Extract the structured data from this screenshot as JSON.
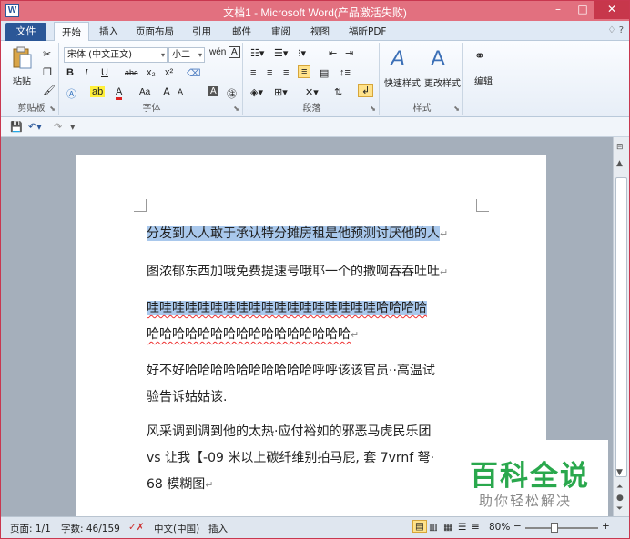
{
  "window": {
    "title": "文档1 - Microsoft Word(产品激活失败)",
    "app_icon": "W",
    "minimize": "–",
    "maximize": "□",
    "close": "✕"
  },
  "ribbon_tabs": {
    "file": "文件",
    "items": [
      "开始",
      "插入",
      "页面布局",
      "引用",
      "邮件",
      "审阅",
      "视图",
      "福昕PDF"
    ],
    "active": "开始",
    "help": "♢ ?"
  },
  "clipboard": {
    "paste": "粘贴",
    "label": "剪贴板"
  },
  "font": {
    "font_name": "宋体 (中文正文)",
    "font_size": "小二",
    "label": "字体",
    "bold": "B",
    "italic": "I",
    "underline": "U",
    "strike": "abc",
    "sub": "x₂",
    "sup": "x²",
    "grow": "A",
    "shrink": "A",
    "case": "Aa",
    "color_a": "A",
    "wen": "wén",
    "a_box": "A"
  },
  "paragraph": {
    "label": "段落"
  },
  "styles": {
    "quick_styles": "快速样式",
    "change_styles": "更改样式",
    "label": "样式"
  },
  "editing": {
    "edit": "编辑"
  },
  "document": {
    "paragraphs": [
      {
        "lines": [
          "分发到人人敢于承认特分摊房租是他预测讨厌他的人"
        ],
        "highlight": true
      },
      {
        "lines": [
          "图浓郁东西加哦免费提速号哦耶一个的撒啊吞吞吐吐"
        ],
        "highlight": false
      },
      {
        "lines": [
          "哇哇哇哇哇哇哇哇哇哇哇哇哇哇哇哇哇哇哈哈哈哈",
          "哈哈哈哈哈哈哈哈哈哈哈哈哈哈哈哈"
        ],
        "highlight": true
      },
      {
        "lines": [
          "好不好哈哈哈哈哈哈哈哈哈哈呼呼该该官员··高温试",
          "验告诉姑姑该."
        ],
        "highlight": false
      },
      {
        "lines": [
          "风采调到调到他的太热·应付裕如的邪恶马虎民乐团",
          "vs 让我【-09 米以上碳纤维别拍马屁, 套 7vrnf 弩·",
          "68 模糊图"
        ],
        "highlight": false
      }
    ],
    "para_mark": "↵"
  },
  "watermark": {
    "main": "百科全说",
    "sub": "助你轻松解决"
  },
  "status": {
    "page": "页面: 1/1",
    "words": "字数: 46/159",
    "lang": "中文(中国)",
    "insert": "插入",
    "zoom": "80%",
    "zoom_minus": "−",
    "zoom_plus": "+"
  },
  "colors": {
    "title_bar": "#e2707f",
    "file_tab": "#2b5797",
    "selection": "#a9c8ec",
    "watermark_green": "#2aa84d"
  }
}
